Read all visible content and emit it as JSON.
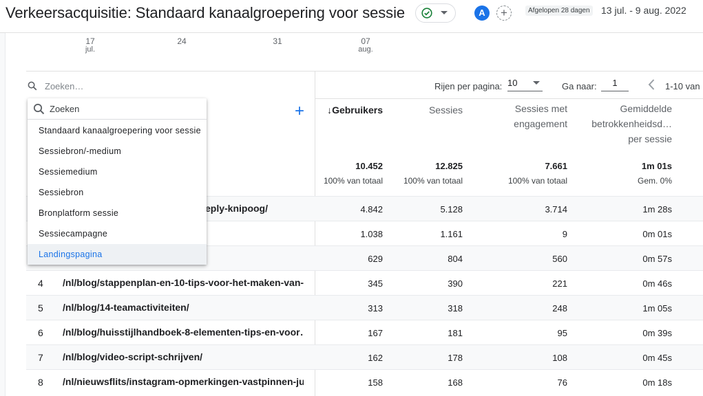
{
  "header": {
    "title": "Verkeersacquisitie: Standaard kanaalgroepering voor sessie",
    "avatar_letter": "A",
    "compare_plus": "+",
    "date_chip": "Afgelopen 28 dagen",
    "date_range": "13 jul. - 9 aug. 2022"
  },
  "axis": {
    "ticks": [
      {
        "day": "17",
        "month": "jul."
      },
      {
        "day": "24",
        "month": ""
      },
      {
        "day": "31",
        "month": ""
      },
      {
        "day": "07",
        "month": "aug."
      }
    ]
  },
  "toolbar": {
    "search_placeholder": "Zoeken…",
    "rows_per_page_label": "Rijen per pagina:",
    "rows_per_page_value": "10",
    "goto_label": "Ga naar:",
    "goto_value": "1",
    "range_label": "1-10 van"
  },
  "columns": [
    {
      "label": "↓Gebruikers",
      "sorted": true
    },
    {
      "label": "Sessies"
    },
    {
      "label": "Sessies met engagement"
    },
    {
      "label": "Gemiddelde betrokkenheidsd… per sessie"
    }
  ],
  "totals": [
    {
      "value": "10.452",
      "sub": "100% van totaal"
    },
    {
      "value": "12.825",
      "sub": "100% van totaal"
    },
    {
      "value": "7.661",
      "sub": "100% van totaal"
    },
    {
      "value": "1m 01s",
      "sub": "Gem. 0%"
    }
  ],
  "rows": [
    {
      "idx": "",
      "dim": "eply-knipoog/",
      "values": [
        "4.842",
        "5.128",
        "3.714",
        "1m 28s"
      ]
    },
    {
      "idx": "",
      "dim": "",
      "values": [
        "1.038",
        "1.161",
        "9",
        "0m 01s"
      ]
    },
    {
      "idx": "",
      "dim": "",
      "values": [
        "629",
        "804",
        "560",
        "0m 57s"
      ]
    },
    {
      "idx": "4",
      "dim": "/nl/blog/stappenplan-en-10-tips-voor-het-maken-van-…",
      "values": [
        "345",
        "390",
        "221",
        "0m 46s"
      ]
    },
    {
      "idx": "5",
      "dim": "/nl/blog/14-teamactiviteiten/",
      "values": [
        "313",
        "318",
        "248",
        "1m 05s"
      ]
    },
    {
      "idx": "6",
      "dim": "/nl/blog/huisstijlhandboek-8-elementen-tips-en-voor…",
      "values": [
        "167",
        "181",
        "95",
        "0m 39s"
      ]
    },
    {
      "idx": "7",
      "dim": "/nl/blog/video-script-schrijven/",
      "values": [
        "162",
        "178",
        "108",
        "0m 45s"
      ]
    },
    {
      "idx": "8",
      "dim": "/nl/nieuwsflits/instagram-opmerkingen-vastpinnen-ju…",
      "values": [
        "158",
        "168",
        "76",
        "0m 18s"
      ]
    }
  ],
  "dropdown": {
    "search_label": "Zoeken",
    "items": [
      {
        "label": "Standaard kanaalgroepering voor sessie",
        "active": false
      },
      {
        "label": "Sessiebron/-medium",
        "active": false
      },
      {
        "label": "Sessiemedium",
        "active": false
      },
      {
        "label": "Sessiebron",
        "active": false
      },
      {
        "label": "Bronplatform sessie",
        "active": false
      },
      {
        "label": "Sessiecampagne",
        "active": false
      },
      {
        "label": "Landingspagina",
        "active": true
      }
    ]
  },
  "colors": {
    "accent": "#1a73e8",
    "check_green": "#188038",
    "row_alt": "#f8f9fa"
  }
}
